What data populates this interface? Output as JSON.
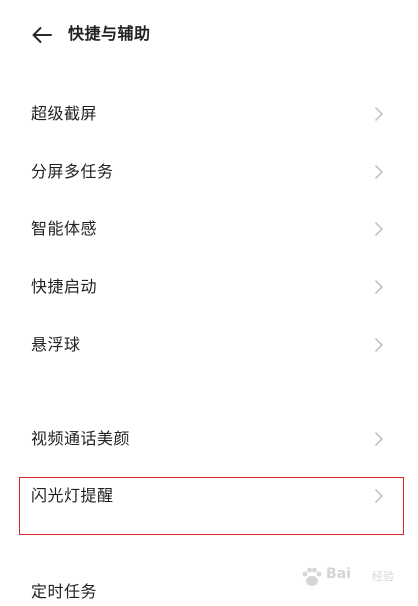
{
  "header": {
    "title": "快捷与辅助",
    "back_icon": "arrow-left-icon"
  },
  "menu": {
    "items": [
      {
        "label": "超级截屏",
        "icon": "chevron-right-icon"
      },
      {
        "label": "分屏多任务",
        "icon": "chevron-right-icon"
      },
      {
        "label": "智能体感",
        "icon": "chevron-right-icon"
      },
      {
        "label": "快捷启动",
        "icon": "chevron-right-icon"
      },
      {
        "label": "悬浮球",
        "icon": "chevron-right-icon"
      },
      {
        "label": "视频通话美颜",
        "icon": "chevron-right-icon"
      },
      {
        "label": "闪光灯提醒",
        "icon": "chevron-right-icon",
        "highlighted": true
      },
      {
        "label": "定时任务",
        "icon": "chevron-right-icon"
      }
    ]
  },
  "watermark": {
    "text": "Bai",
    "sub": "经验",
    "icon": "paw-icon"
  },
  "colors": {
    "text": "#222222",
    "chevron": "#c4c4c4",
    "highlight_border": "#d9262a",
    "background": "#ffffff"
  }
}
